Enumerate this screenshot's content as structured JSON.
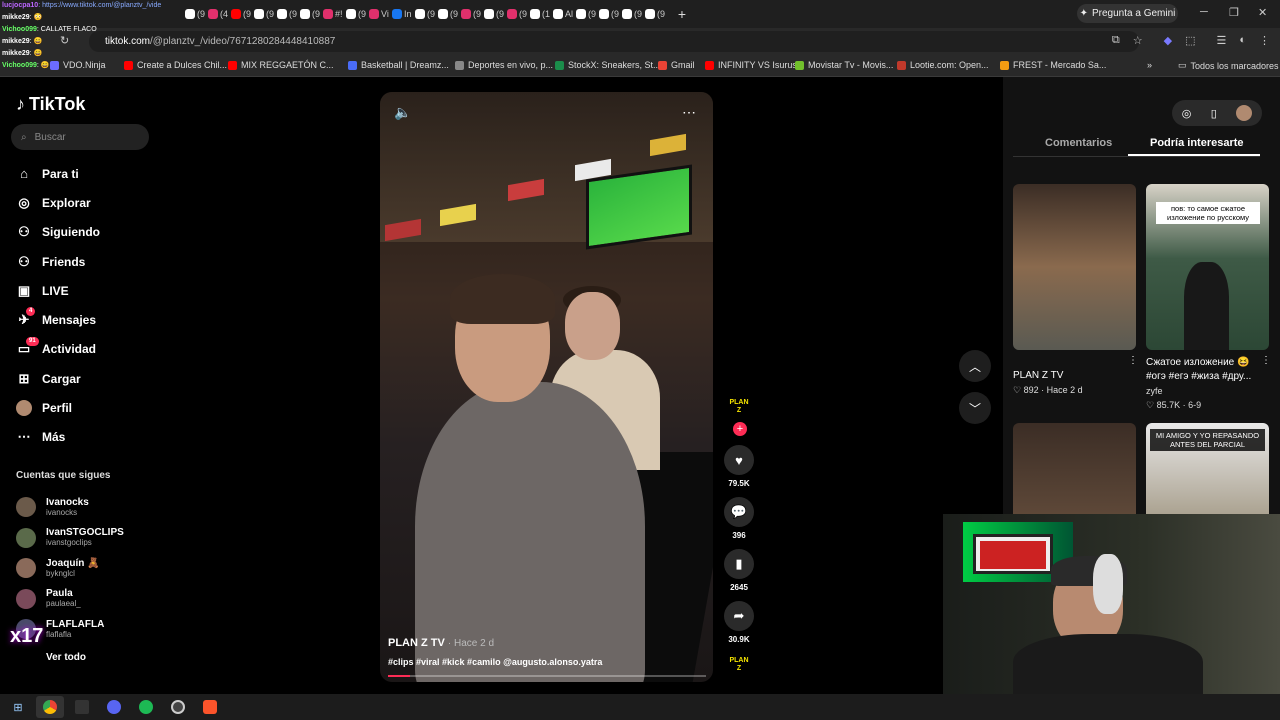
{
  "browser": {
    "tabs": [
      "(9",
      "(4",
      "(9",
      "(9",
      "(9",
      "(9",
      "#!",
      "(9",
      "Vi",
      "In",
      "(9",
      "(9",
      "(9",
      "(9",
      "(9",
      "(1",
      "Al",
      "(9",
      "(9",
      "(9",
      "(9"
    ],
    "tab_colors": [
      "#ffffff",
      "#e1306c",
      "#ff0000",
      "#ffffff",
      "#ffffff",
      "#ffffff",
      "#e1306c",
      "#ffffff",
      "#e1306c",
      "#1877f2",
      "#ffffff",
      "#ffffff",
      "#e1306c",
      "#ffffff",
      "#e1306c",
      "#ffffff",
      "#ffffff",
      "#ffffff",
      "#ffffff",
      "#ffffff",
      "#ffffff"
    ],
    "gemini_label": "Pregunta a Gemini",
    "url_domain": "tiktok.com",
    "url_path": "/@planztv_/video/7671280284448410887",
    "bookmarks": [
      {
        "label": "VDO.Ninja",
        "color": "#6c6cff"
      },
      {
        "label": "Create a Dulces Chil...",
        "color": "#ff0000"
      },
      {
        "label": "MIX REGGAETÓN C...",
        "color": "#ff0000"
      },
      {
        "label": "Basketball | Dreamz...",
        "color": "#4a6cf7"
      },
      {
        "label": "Deportes en vivo, p...",
        "color": "#888888"
      },
      {
        "label": "StockX: Sneakers, St...",
        "color": "#1b8d4b"
      },
      {
        "label": "Gmail",
        "color": "#ea4335"
      },
      {
        "label": "INFINITY VS Isurus",
        "color": "#ff0000"
      },
      {
        "label": "Movistar Tv - Movis...",
        "color": "#72c02c"
      },
      {
        "label": "Lootie.com: Open...",
        "color": "#c0392b"
      },
      {
        "label": "FREST - Mercado Sa...",
        "color": "#f39c12"
      }
    ],
    "bookmarks_more": "»",
    "all_bookmarks": "Todos los marcadores"
  },
  "chat": [
    {
      "user": "lucjocpa10",
      "msg": ": https://www.tiktok.com/@planztv_/vide"
    },
    {
      "user": "mikke29",
      "msg": ": 😳"
    },
    {
      "user": "Vichoo099",
      "msg": ": CALLATE FLACO"
    },
    {
      "user": "mikke29",
      "msg": ": 😄"
    },
    {
      "user": "mikke29",
      "msg": ": 😄"
    },
    {
      "user": "Vichoo099",
      "msg": ": 😄"
    }
  ],
  "tiktok": {
    "brand": "TikTok",
    "search_placeholder": "Buscar",
    "nav": [
      {
        "label": "Para ti",
        "icon": "home-icon",
        "glyph": "⌂"
      },
      {
        "label": "Explorar",
        "icon": "compass-icon",
        "glyph": "◎"
      },
      {
        "label": "Siguiendo",
        "icon": "following-icon",
        "glyph": "⚇"
      },
      {
        "label": "Friends",
        "icon": "friends-icon",
        "glyph": "⚇"
      },
      {
        "label": "LIVE",
        "icon": "live-icon",
        "glyph": "▣"
      },
      {
        "label": "Mensajes",
        "icon": "messages-icon",
        "glyph": "✈",
        "badge": "4"
      },
      {
        "label": "Actividad",
        "icon": "activity-icon",
        "glyph": "▭",
        "badge": "91"
      },
      {
        "label": "Cargar",
        "icon": "upload-icon",
        "glyph": "⊞"
      },
      {
        "label": "Perfil",
        "icon": "profile-icon",
        "glyph": ""
      },
      {
        "label": "Más",
        "icon": "more-icon",
        "glyph": "⋯"
      }
    ],
    "following_title": "Cuentas que sigues",
    "following": [
      {
        "name": "Ivanocks",
        "user": "ivanocks",
        "color": "#6b5a4a"
      },
      {
        "name": "IvanSTGOCLIPS",
        "user": "ivanstgoclips",
        "color": "#5a6a4a"
      },
      {
        "name": "Joaquín 🧸",
        "user": "byknglcl",
        "color": "#8a6a5a"
      },
      {
        "name": "Paula",
        "user": "paulaeal_",
        "color": "#7a4a5a"
      },
      {
        "name": "FLAFLAFLA",
        "user": "flaflafla",
        "color": "#4a4a6a"
      }
    ],
    "see_all": "Ver todo"
  },
  "video": {
    "author": "PLAN Z TV",
    "posted": "· Hace 2 d",
    "caption": "#clips #viral #kick #camilo @augusto.alonso.yatra",
    "progress": 0.07,
    "likes": "79.5K",
    "comments": "396",
    "saves": "2645",
    "shares": "30.9K",
    "channel_badge": "PLAN Z"
  },
  "panel": {
    "tabs": [
      "Comentarios",
      "Podría interesarte"
    ],
    "cards": [
      {
        "title": "PLAN Z TV",
        "likes": "892",
        "time": "· Hace 2 d",
        "overlay": ""
      },
      {
        "title": "Сжатое изложение 😆 #огэ #егэ #жиза #дру...",
        "user": "zyfe",
        "likes": "85.7K",
        "time": "· 6-9",
        "overlay": "пов: то самое сжатое изложение по русскому"
      },
      {
        "title": "",
        "overlay": ""
      },
      {
        "title": "",
        "overlay": "MI AMIGO Y YO REPASANDO ANTES DEL PARCIAL"
      }
    ]
  },
  "overlay": {
    "emote_text": "x17"
  }
}
